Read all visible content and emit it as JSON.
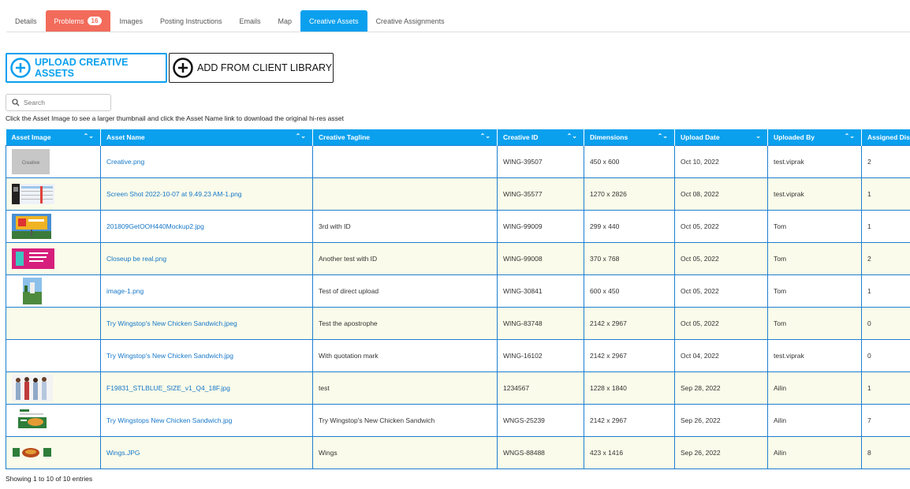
{
  "tabs": [
    {
      "label": "Details"
    },
    {
      "label": "Problems",
      "badge": "16"
    },
    {
      "label": "Images"
    },
    {
      "label": "Posting Instructions"
    },
    {
      "label": "Emails"
    },
    {
      "label": "Map"
    },
    {
      "label": "Creative Assets"
    },
    {
      "label": "Creative Assignments"
    }
  ],
  "actions": {
    "upload_label": "UPLOAD CREATIVE ASSETS",
    "add_label": "ADD FROM CLIENT LIBRARY"
  },
  "search": {
    "placeholder": "Search",
    "value": ""
  },
  "hint": "Click the Asset Image to see a larger thumbnail and click the Asset Name link to download the original hi-res asset",
  "table": {
    "columns": [
      "Asset Image",
      "Asset Name",
      "Creative Tagline",
      "Creative ID",
      "Dimensions",
      "Upload Date",
      "Uploaded By",
      "Assigned Displ"
    ],
    "rows": [
      {
        "name": "Creative.png",
        "tagline": "",
        "id": "WING-39507",
        "dims": "450 x 600",
        "date": "Oct 10, 2022",
        "by": "test.viprak",
        "assigned": "2",
        "thumb_text": "Creative"
      },
      {
        "name": "Screen Shot 2022-10-07 at 9.49.23 AM-1.png",
        "tagline": "",
        "id": "WING-35577",
        "dims": "1270 x 2826",
        "date": "Oct 08, 2022",
        "by": "test.viprak",
        "assigned": "1"
      },
      {
        "name": "201809GetOOH440Mockup2.jpg",
        "tagline": "3rd with ID",
        "id": "WING-99009",
        "dims": "299 x 440",
        "date": "Oct 05, 2022",
        "by": "Tom",
        "assigned": "1"
      },
      {
        "name": "Closeup be real.png",
        "tagline": "Another test with ID",
        "id": "WING-99008",
        "dims": "370 x 768",
        "date": "Oct 05, 2022",
        "by": "Tom",
        "assigned": "2"
      },
      {
        "name": "image-1.png",
        "tagline": "Test of direct upload",
        "id": "WING-30841",
        "dims": "600 x 450",
        "date": "Oct 05, 2022",
        "by": "Tom",
        "assigned": "1"
      },
      {
        "name": "Try Wingstop's New Chicken Sandwich.jpeg",
        "tagline": "Test the apostrophe",
        "id": "WING-83748",
        "dims": "2142 x 2967",
        "date": "Oct 05, 2022",
        "by": "Tom",
        "assigned": "0"
      },
      {
        "name": "Try Wingstop's New Chicken Sandwich.jpg",
        "tagline": "With quotation mark",
        "id": "WING-16102",
        "dims": "2142 x 2967",
        "date": "Oct 04, 2022",
        "by": "test.viprak",
        "assigned": "0"
      },
      {
        "name": "F19831_STLBLUE_SIZE_v1_Q4_18F.jpg",
        "tagline": "test",
        "id": "1234567",
        "dims": "1228 x 1840",
        "date": "Sep 28, 2022",
        "by": "Ailin",
        "assigned": "1"
      },
      {
        "name": "Try Wingstops New Chicken Sandwich.jpg",
        "tagline": "Try Wingstop's New Chicken Sandwich",
        "id": "WNGS-25239",
        "dims": "2142 x 2967",
        "date": "Sep 26, 2022",
        "by": "Ailin",
        "assigned": "7"
      },
      {
        "name": "Wings.JPG",
        "tagline": "Wings",
        "id": "WNGS-88488",
        "dims": "423 x 1416",
        "date": "Sep 26, 2022",
        "by": "Ailin",
        "assigned": "8"
      }
    ]
  },
  "footer": "Showing 1 to 10 of 10 entries",
  "colors": {
    "accent": "#0aa0ee",
    "problems": "#f26b5b",
    "stripe": "#fafbea",
    "link": "#1677c9"
  }
}
